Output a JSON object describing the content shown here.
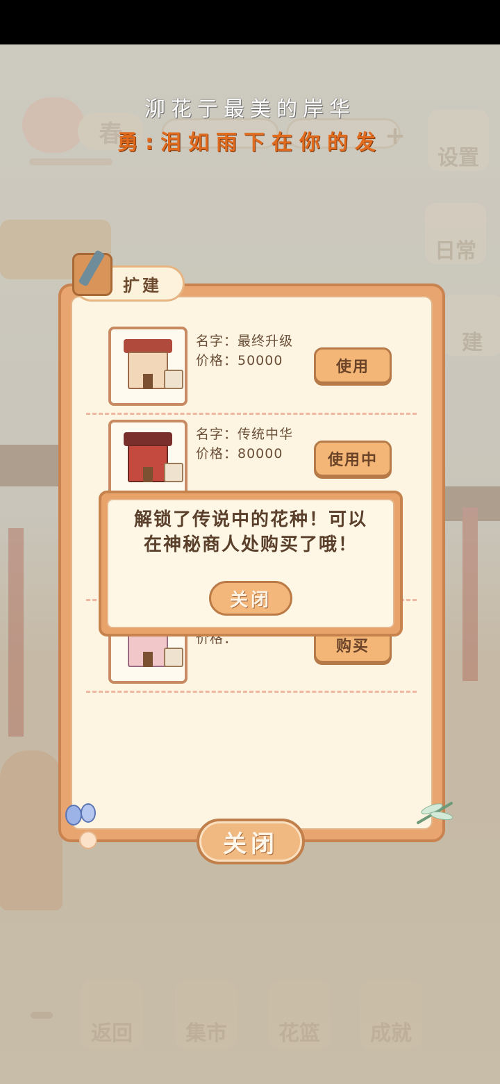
{
  "overlay": {
    "title": "泖花亍最美的岸华",
    "subtitle": "勇:泪如雨下在你的发"
  },
  "hud": {
    "season_label": "春",
    "settings_label": "设置",
    "daily_label": "日常",
    "build_label": "建"
  },
  "dialog": {
    "tab_label": "扩建",
    "items": [
      {
        "name": "名字：最终升级",
        "price": "价格：50000",
        "button": "使用",
        "roof_color": "#b04a3c",
        "body_color": "#f2d7b8"
      },
      {
        "name": "名字：传统中华",
        "price": "价格：80000",
        "button": "使用中",
        "roof_color": "#7b2f2c",
        "body_color": "#c44a3f"
      },
      {
        "name": "",
        "price": "价格：",
        "button": "购买",
        "roof_color": "#8e4a8a",
        "body_color": "#f1c7c9"
      }
    ],
    "close_label": "关闭"
  },
  "popup": {
    "message_line1": "解锁了传说中的花种！可以",
    "message_line2": "在神秘商人处购买了哦！",
    "close_label": "关闭"
  },
  "bottom_nav": {
    "items": [
      {
        "label": "返回"
      },
      {
        "label": "集市"
      },
      {
        "label": "花篮"
      },
      {
        "label": "成就"
      }
    ]
  }
}
